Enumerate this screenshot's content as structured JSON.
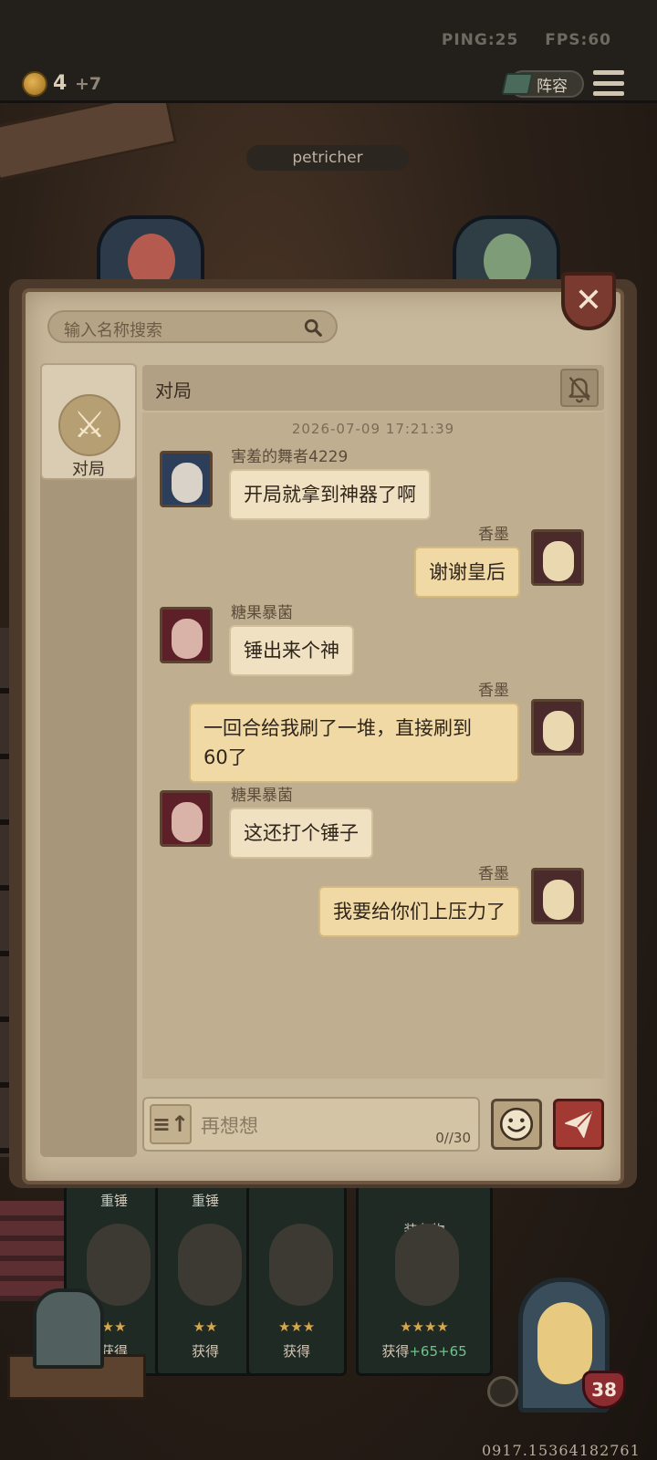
{
  "hud": {
    "ping": "PING:25",
    "fps": "FPS:60",
    "coins": "4",
    "coin_gain": "+7",
    "lineup_label": "阵容",
    "player_name": "petricher",
    "hp": "38",
    "uid": "0917.15364182761"
  },
  "cards": [
    {
      "label": "重锤",
      "gain_prefix": "获得",
      "gain": ""
    },
    {
      "label": "重锤",
      "gain_prefix": "获得",
      "gain": ""
    },
    {
      "label": "",
      "gain_prefix": "获得",
      "gain": ""
    },
    {
      "label": "装备物",
      "gain_prefix": "获得",
      "gain": "+65+65"
    }
  ],
  "chat": {
    "search_placeholder": "输入名称搜索",
    "tab_label": "对局",
    "header_title": "对局",
    "timestamp": "2026-07-09 17:21:39",
    "messages": [
      {
        "sender": "害羞的舞者4229",
        "text": "开局就拿到神器了啊",
        "mine": false
      },
      {
        "sender": "香墨",
        "text": "谢谢皇后",
        "mine": true
      },
      {
        "sender": "糖果暴菌",
        "text": "锤出来个神",
        "mine": false
      },
      {
        "sender": "香墨",
        "text": "一回合给我刷了一堆，直接刷到",
        "text2": "60了",
        "mine": true
      },
      {
        "sender": "糖果暴菌",
        "text": "这还打个锤子",
        "mine": false
      },
      {
        "sender": "香墨",
        "text": "我要给你们上压力了",
        "mine": true
      }
    ],
    "input_placeholder": "再想想",
    "input_count": "0//30"
  }
}
